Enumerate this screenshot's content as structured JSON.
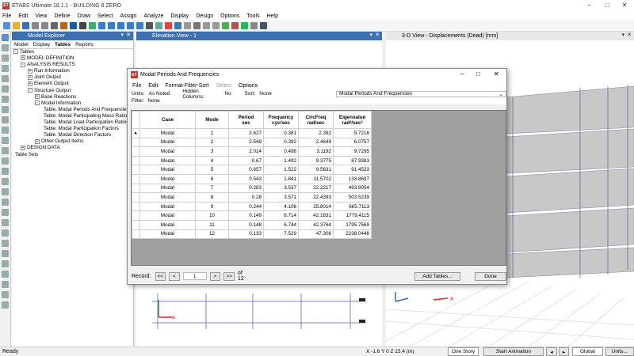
{
  "app": {
    "title": "ETABS Ultimate 18.1.1 - BUILDING 8 ZERO",
    "logo": "ET"
  },
  "menu": [
    "File",
    "Edit",
    "View",
    "Define",
    "Draw",
    "Select",
    "Assign",
    "Analyze",
    "Display",
    "Design",
    "Options",
    "Tools",
    "Help"
  ],
  "explorer": {
    "title": "Model Explorer",
    "tabs": [
      "Model",
      "Display",
      "Tables",
      "Reports"
    ],
    "tree": [
      {
        "indent": 0,
        "toggle": "-",
        "label": "Tables"
      },
      {
        "indent": 1,
        "toggle": "+",
        "label": "MODEL DEFINITION"
      },
      {
        "indent": 1,
        "toggle": "-",
        "label": "ANALYSIS RESULTS"
      },
      {
        "indent": 2,
        "toggle": "+",
        "label": "Run Information"
      },
      {
        "indent": 2,
        "toggle": "+",
        "label": "Joint Output"
      },
      {
        "indent": 2,
        "toggle": "+",
        "label": "Element Output"
      },
      {
        "indent": 2,
        "toggle": "-",
        "label": "Structure Output"
      },
      {
        "indent": 3,
        "toggle": "+",
        "label": "Base Reactions"
      },
      {
        "indent": 3,
        "toggle": "-",
        "label": "Modal Information"
      },
      {
        "indent": 4,
        "toggle": "",
        "label": "Table:  Modal Periods And Frequencies"
      },
      {
        "indent": 4,
        "toggle": "",
        "label": "Table:  Modal Participating Mass Ratios"
      },
      {
        "indent": 4,
        "toggle": "",
        "label": "Table:  Modal Load Participation Ratios"
      },
      {
        "indent": 4,
        "toggle": "",
        "label": "Table:  Modal Participation Factors"
      },
      {
        "indent": 4,
        "toggle": "",
        "label": "Table:  Modal Direction Factors"
      },
      {
        "indent": 3,
        "toggle": "+",
        "label": "Other Output Items"
      },
      {
        "indent": 1,
        "toggle": "+",
        "label": "DESIGN DATA"
      },
      {
        "indent": 0,
        "toggle": "",
        "label": "Table Sets"
      }
    ]
  },
  "elevation": {
    "title": "Elevation View - 1"
  },
  "view3d": {
    "title": "3-D View  - Displacements (Dead)  [mm]"
  },
  "dialog": {
    "title": "Modal Periods And Frequencies",
    "menu": [
      "File",
      "Edit",
      "Format-Filter-Sort",
      "Select",
      "Options"
    ],
    "units_label": "Units:",
    "units_value": "As Noted",
    "hidden_label": "Hidden Columns:",
    "hidden_value": "No",
    "sort_label": "Sort:",
    "sort_value": "None",
    "table_select": "Modal Periods And Frequencies",
    "filter_label": "Filter:",
    "filter_value": "None",
    "columns": [
      {
        "line1": "Case",
        "line2": ""
      },
      {
        "line1": "Mode",
        "line2": ""
      },
      {
        "line1": "Period",
        "line2": "sec"
      },
      {
        "line1": "Frequency",
        "line2": "cyc/sec"
      },
      {
        "line1": "CircFreq",
        "line2": "rad/sec"
      },
      {
        "line1": "Eigenvalue",
        "line2": "rad²/sec²"
      }
    ],
    "rows": [
      [
        "Modal",
        "1",
        "2.627",
        "0.381",
        "2.392",
        "5.7216"
      ],
      [
        "Modal",
        "2",
        "2.549",
        "0.392",
        "2.4649",
        "6.0757"
      ],
      [
        "Modal",
        "3",
        "2.014",
        "0.496",
        "3.1192",
        "9.7295"
      ],
      [
        "Modal",
        "4",
        "0.67",
        "1.492",
        "9.3775",
        "87.9383"
      ],
      [
        "Modal",
        "5",
        "0.657",
        "1.522",
        "9.5631",
        "91.4523"
      ],
      [
        "Modal",
        "6",
        "0.543",
        "1.841",
        "11.5702",
        "133.8697"
      ],
      [
        "Modal",
        "7",
        "0.283",
        "3.537",
        "22.2217",
        "493.8054"
      ],
      [
        "Modal",
        "8",
        "0.28",
        "3.571",
        "22.4393",
        "503.5239"
      ],
      [
        "Modal",
        "9",
        "0.244",
        "4.106",
        "25.8014",
        "665.7113"
      ],
      [
        "Modal",
        "10",
        "0.149",
        "6.714",
        "42.1831",
        "1779.4115"
      ],
      [
        "Modal",
        "11",
        "0.148",
        "6.744",
        "42.3764",
        "1795.7569"
      ],
      [
        "Modal",
        "12",
        "0.133",
        "7.529",
        "47.308",
        "2238.0448"
      ]
    ],
    "record_label": "Record:",
    "record_value": "1",
    "record_total": "of 12",
    "nav": [
      "<<",
      "<",
      ">",
      ">>"
    ],
    "add_tables": "Add Tables...",
    "done": "Done"
  },
  "status": {
    "left": "Ready",
    "coords": "X -1.6  Y 0  Z 15.4 (m)",
    "stories": "One Story",
    "animation": "Start Animation",
    "global": "Global",
    "units": "Units..."
  }
}
